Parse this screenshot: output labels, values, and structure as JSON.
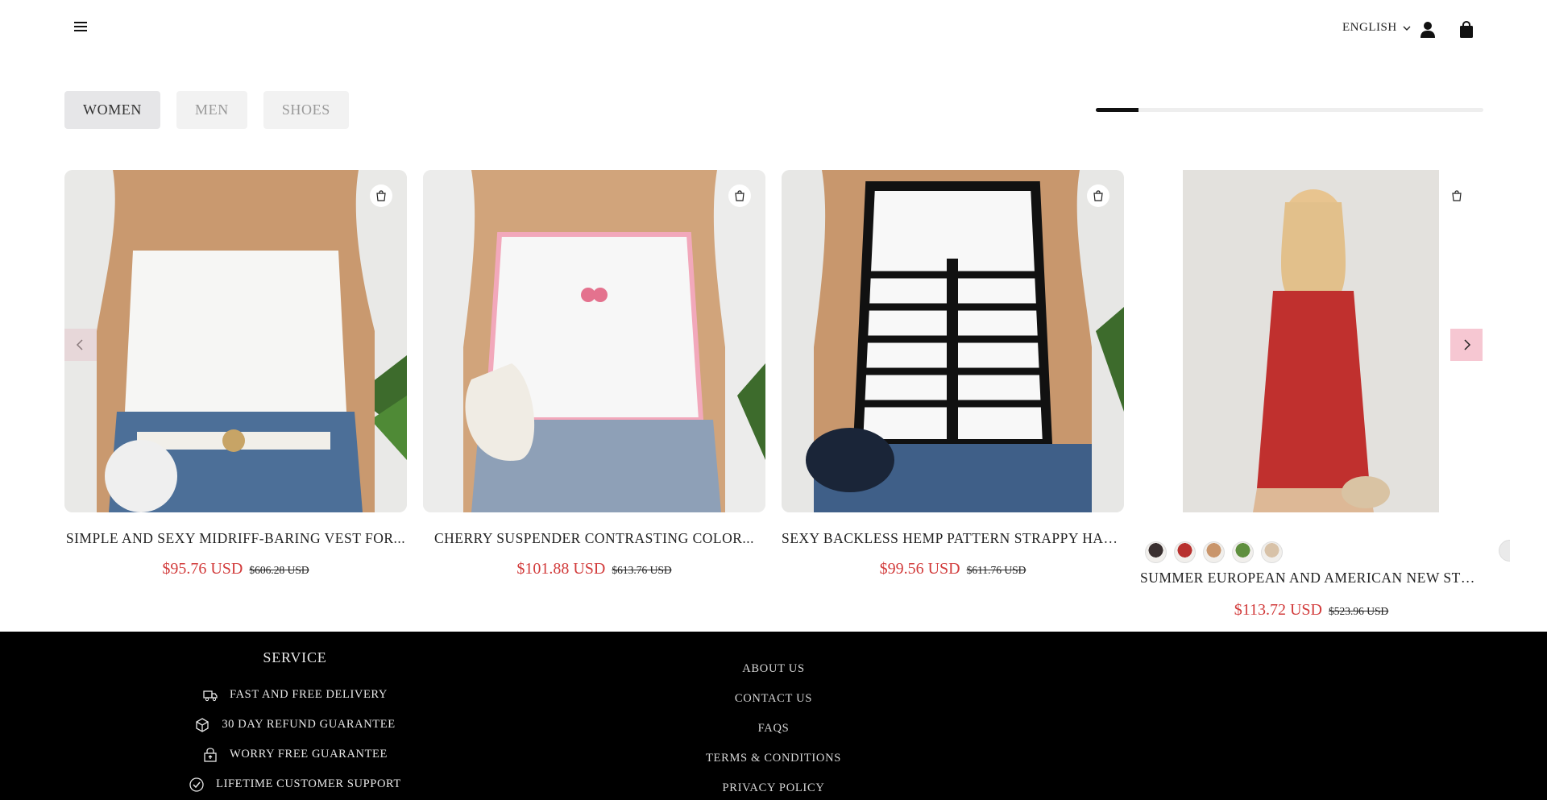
{
  "header": {
    "language": "ENGLISH",
    "icons": [
      "menu-icon",
      "chevron-down-icon",
      "user-icon",
      "shopping-bag-icon"
    ]
  },
  "tabs": [
    {
      "label": "WOMEN",
      "active": true
    },
    {
      "label": "MEN",
      "active": false
    },
    {
      "label": "SHOES",
      "active": false
    }
  ],
  "carousel": {
    "progress_fraction": 0.11
  },
  "products": [
    {
      "title": "SIMPLE AND SEXY MIDRIFF-BARING VEST FOR...",
      "price": "$95.76 USD",
      "old_price": "$606.28 USD"
    },
    {
      "title": "CHERRY SUSPENDER CONTRASTING COLOR...",
      "price": "$101.88 USD",
      "old_price": "$613.76 USD"
    },
    {
      "title": "SEXY BACKLESS HEMP PATTERN STRAPPY HALTER...",
      "price": "$99.56 USD",
      "old_price": "$611.76 USD"
    },
    {
      "title": "SUMMER EUROPEAN AND AMERICAN NEW STYL...",
      "price": "$113.72 USD",
      "old_price": "$523.96 USD",
      "swatches": [
        "#3a3030",
        "#b8312f",
        "#c9956b",
        "#5f8f3e",
        "#d8c2a8"
      ]
    }
  ],
  "colors": {
    "price": "#d23b3b",
    "footer_bg": "#000000",
    "next_arrow_bg": "#f6c7d2"
  },
  "footer": {
    "service_title": "SERVICE",
    "service_items": [
      {
        "icon": "delivery-truck-icon",
        "label": "FAST AND FREE DELIVERY"
      },
      {
        "icon": "box-icon",
        "label": "30 DAY REFUND GUARANTEE"
      },
      {
        "icon": "lock-icon",
        "label": "WORRY FREE GUARANTEE"
      },
      {
        "icon": "check-circle-icon",
        "label": "LIFETIME CUSTOMER SUPPORT"
      }
    ],
    "links": [
      "ABOUT US",
      "CONTACT US",
      "FAQS",
      "TERMS & CONDITIONS",
      "PRIVACY POLICY"
    ]
  }
}
